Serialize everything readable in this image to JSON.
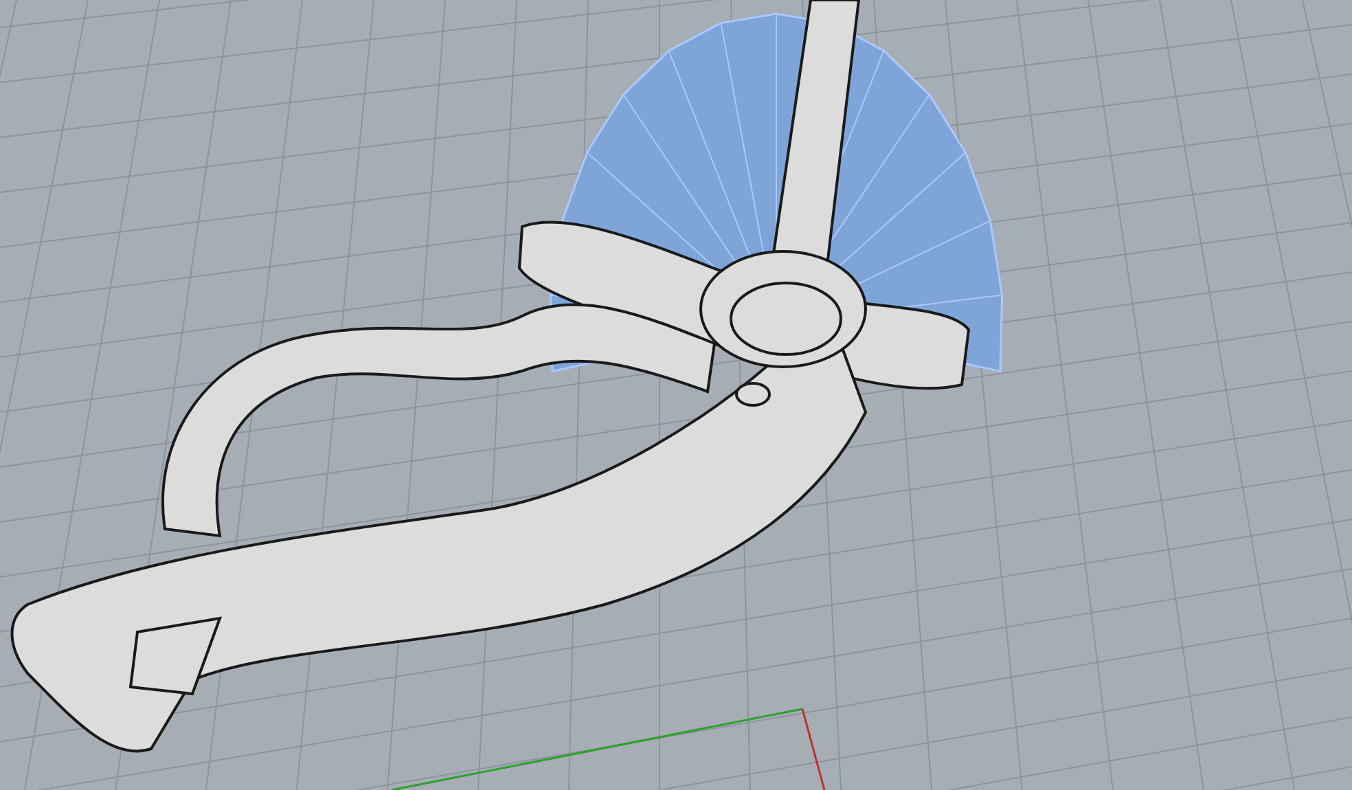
{
  "viewport": {
    "grid": true,
    "axes": true
  },
  "objects": [
    {
      "kind": "fan-surface",
      "selected": true
    },
    {
      "kind": "clip",
      "selected": false
    }
  ]
}
